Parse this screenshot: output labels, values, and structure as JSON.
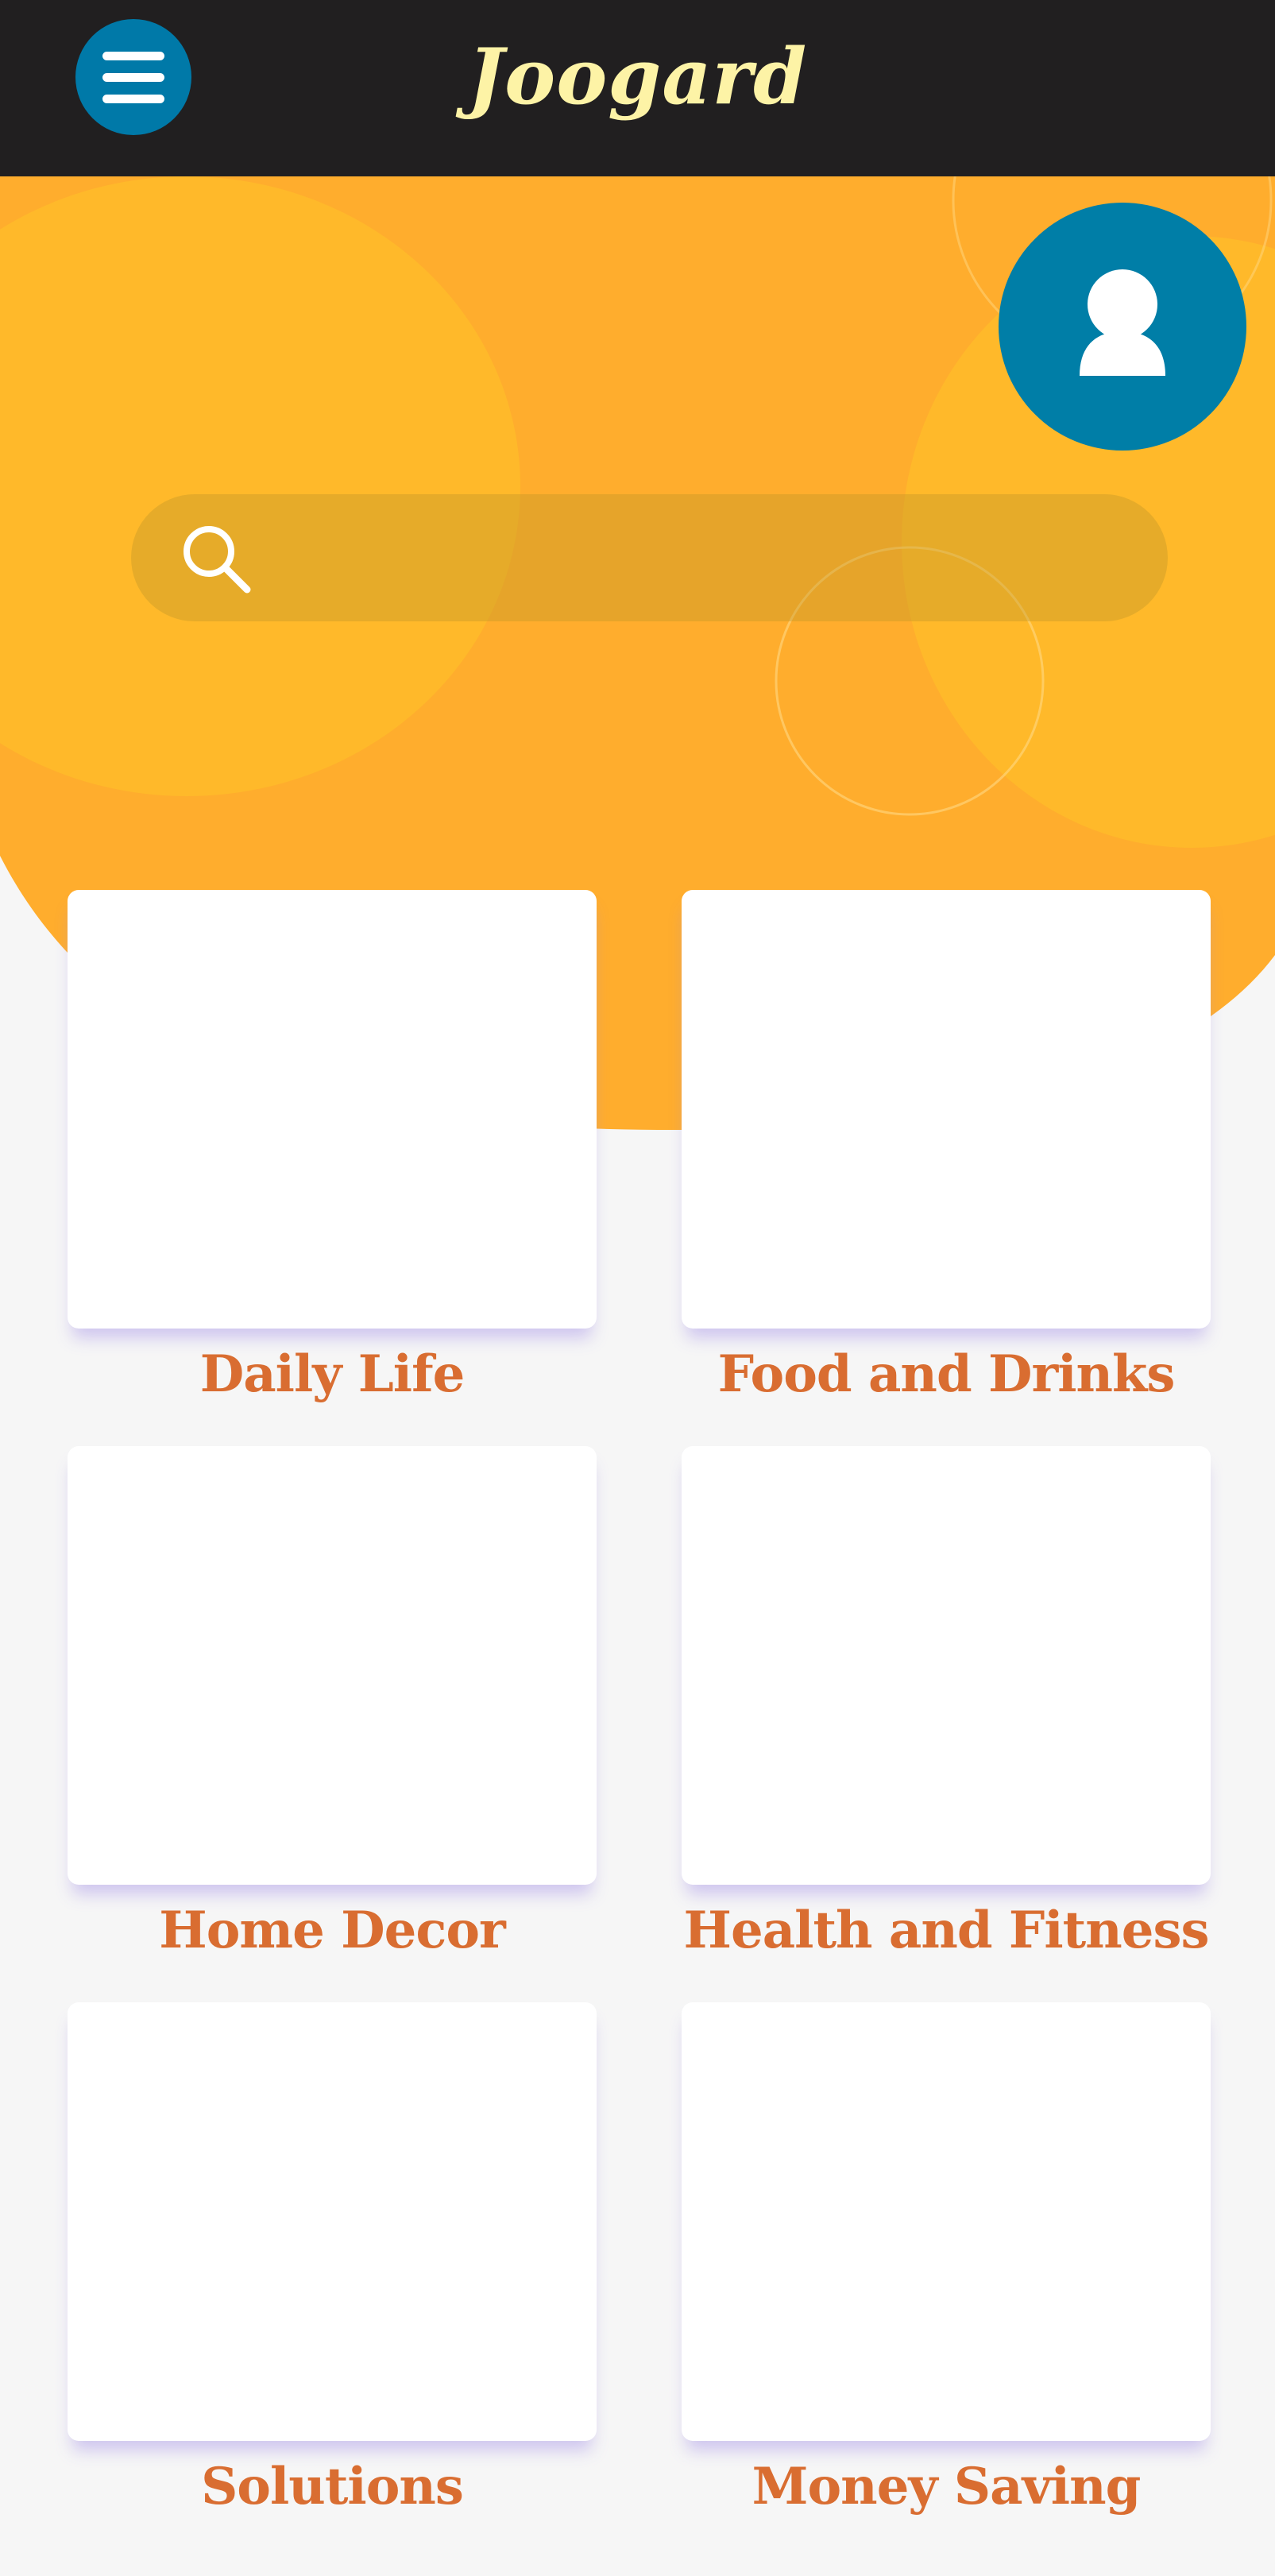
{
  "header": {
    "brand": "Joogard",
    "menu_icon": "hamburger-menu-icon"
  },
  "profile": {
    "icon": "user-avatar-icon"
  },
  "search": {
    "icon": "search-icon",
    "placeholder": "",
    "value": ""
  },
  "colors": {
    "header_bg": "#211f20",
    "brand_text": "#fdf3a6",
    "hero_orange": "#ffad2d",
    "hero_circle": "#ffb92a",
    "accent_blue": "#007ea7",
    "category_text": "#d96d31",
    "page_bg": "#f6f6f6"
  },
  "categories": [
    {
      "label": "Daily Life"
    },
    {
      "label": "Food and Drinks"
    },
    {
      "label": "Home Decor"
    },
    {
      "label": "Health and Fitness"
    },
    {
      "label": "Solutions"
    },
    {
      "label": "Money Saving"
    }
  ]
}
